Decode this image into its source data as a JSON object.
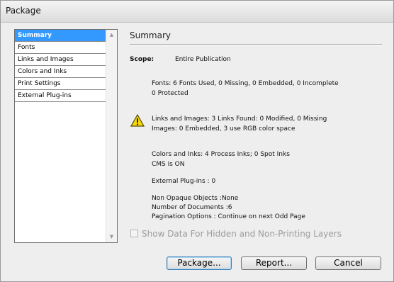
{
  "window": {
    "title": "Package"
  },
  "sidebar": {
    "items": [
      {
        "label": "Summary",
        "selected": true
      },
      {
        "label": "Fonts"
      },
      {
        "label": "Links and Images"
      },
      {
        "label": "Colors and Inks"
      },
      {
        "label": "Print Settings"
      },
      {
        "label": "External Plug-ins"
      }
    ]
  },
  "summary": {
    "heading": "Summary",
    "scope_label": "Scope:",
    "scope_value": "Entire Publication",
    "fonts_line1": "Fonts: 6 Fonts Used, 0 Missing, 0 Embedded, 0 Incomplete",
    "fonts_line2": "0 Protected",
    "links_line1": "Links and Images: 3 Links Found: 0 Modified, 0 Missing",
    "links_line2": "Images: 0 Embedded, 3 use RGB color space",
    "colors_line1": "Colors and Inks: 4 Process Inks; 0 Spot Inks",
    "colors_line2": "CMS is ON",
    "plugins": "External Plug-ins : 0",
    "opaque": "Non Opaque Objects :None",
    "documents": "Number of Documents :6",
    "pagination": "Pagination Options : Continue on next Odd Page",
    "warning_icon": "warning-triangle-icon"
  },
  "options": {
    "show_hidden_label": "Show Data For Hidden and Non-Printing Layers",
    "show_hidden_checked": false
  },
  "buttons": {
    "package": "Package...",
    "report": "Report...",
    "cancel": "Cancel"
  }
}
